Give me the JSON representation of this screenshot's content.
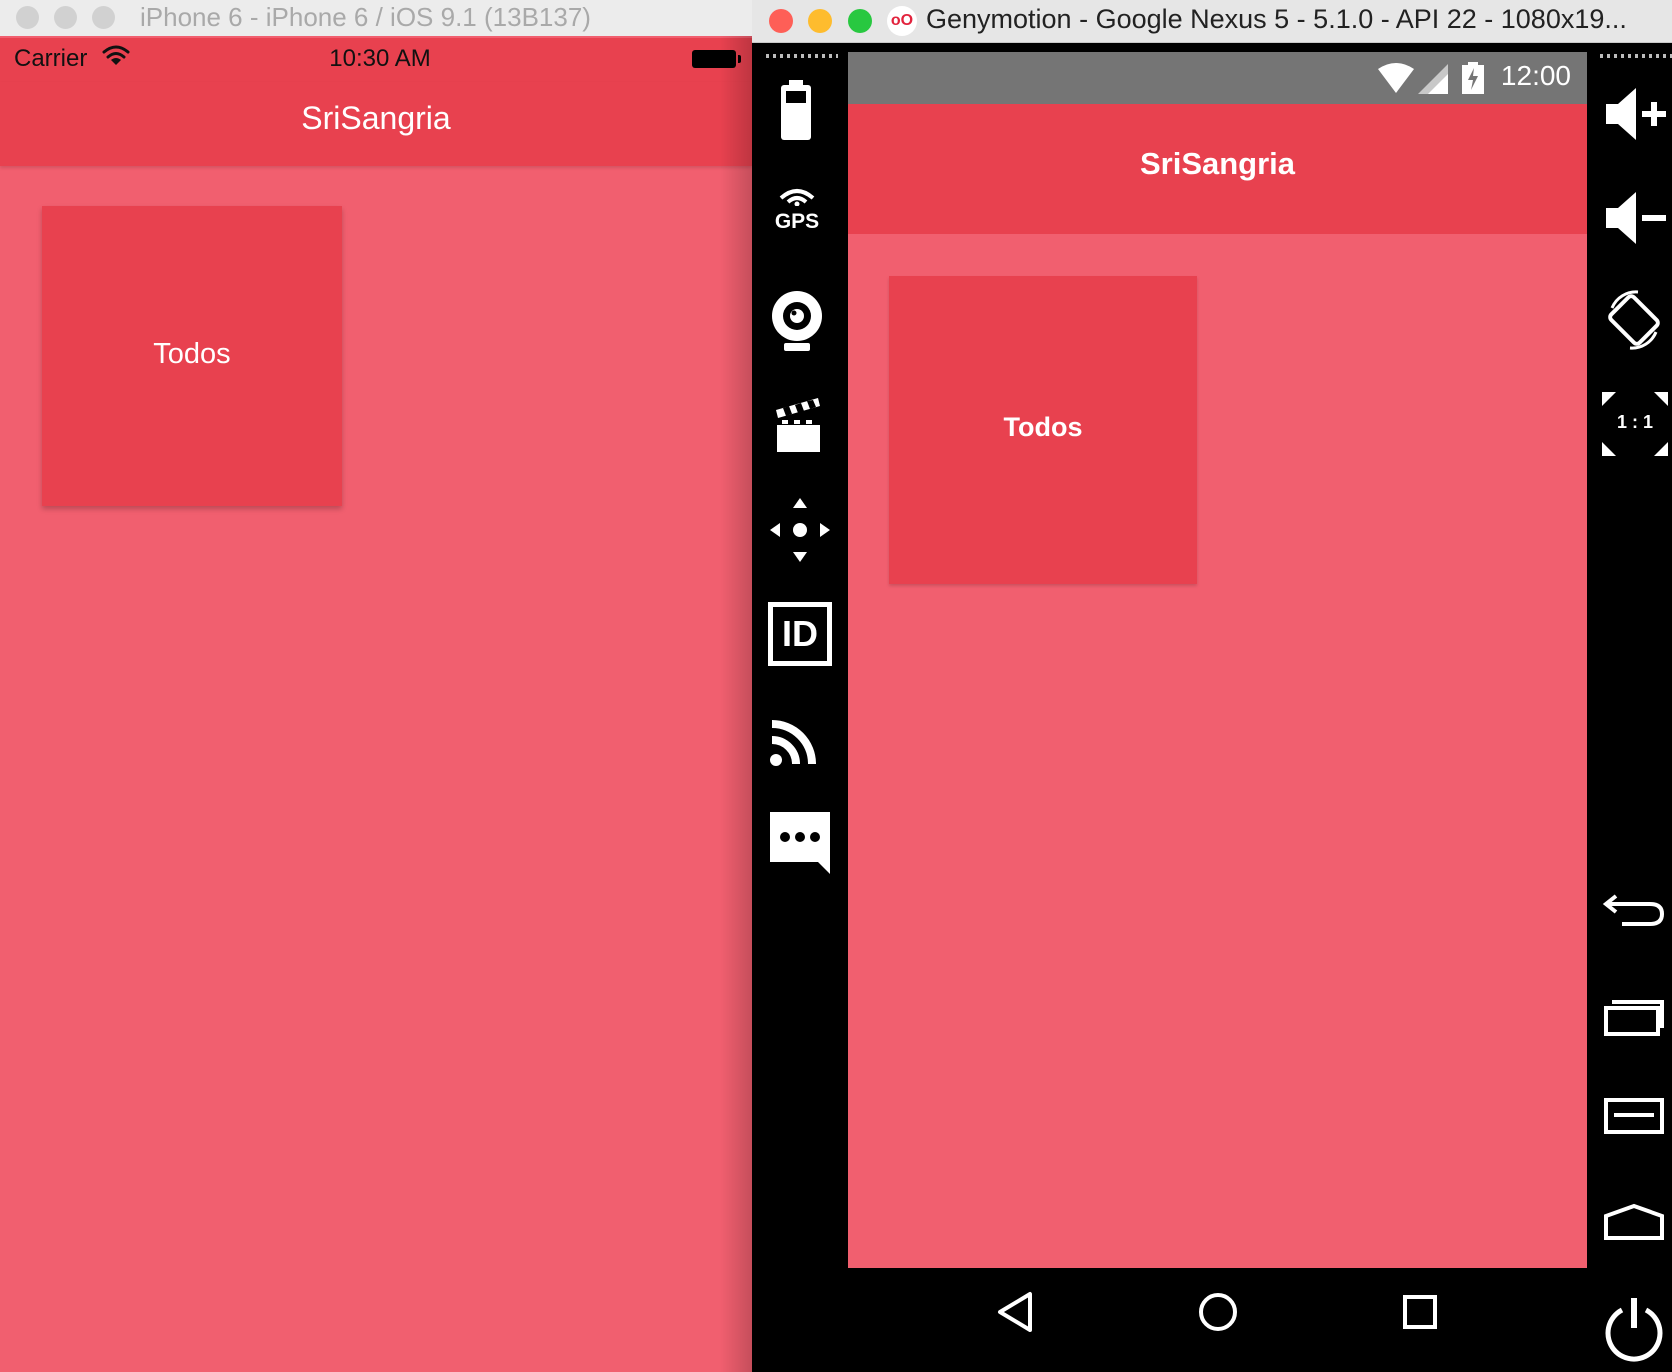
{
  "ios": {
    "window_title": "iPhone 6 - iPhone 6 / iOS 9.1 (13B137)",
    "status": {
      "carrier": "Carrier",
      "time": "10:30 AM"
    },
    "app_title": "SriSangria",
    "tile_label": "Todos"
  },
  "genymotion": {
    "window_title": "Genymotion - Google Nexus 5 - 5.1.0 - API 22 - 1080x19...",
    "logo_text": "oO",
    "left_toolbar": [
      "battery-icon",
      "gps-icon",
      "webcam-icon",
      "capture-icon",
      "dpad-icon",
      "device-id-icon",
      "network-icon",
      "sms-icon"
    ],
    "gps_label": "GPS",
    "id_label": "ID",
    "scale_label": "1 : 1",
    "right_toolbar": [
      "volume-up-icon",
      "volume-down-icon",
      "rotate-icon",
      "scale-icon",
      "back-icon",
      "recent-apps-icon",
      "menu-icon",
      "home-icon",
      "power-icon"
    ]
  },
  "android": {
    "status": {
      "time": "12:00"
    },
    "app_title": "SriSangria",
    "tile_label": "Todos",
    "navbar": [
      "back-icon",
      "home-icon",
      "recents-icon"
    ]
  },
  "colors": {
    "primary": "#e8414f",
    "background": "#f15f6f",
    "android_status": "#757575"
  }
}
